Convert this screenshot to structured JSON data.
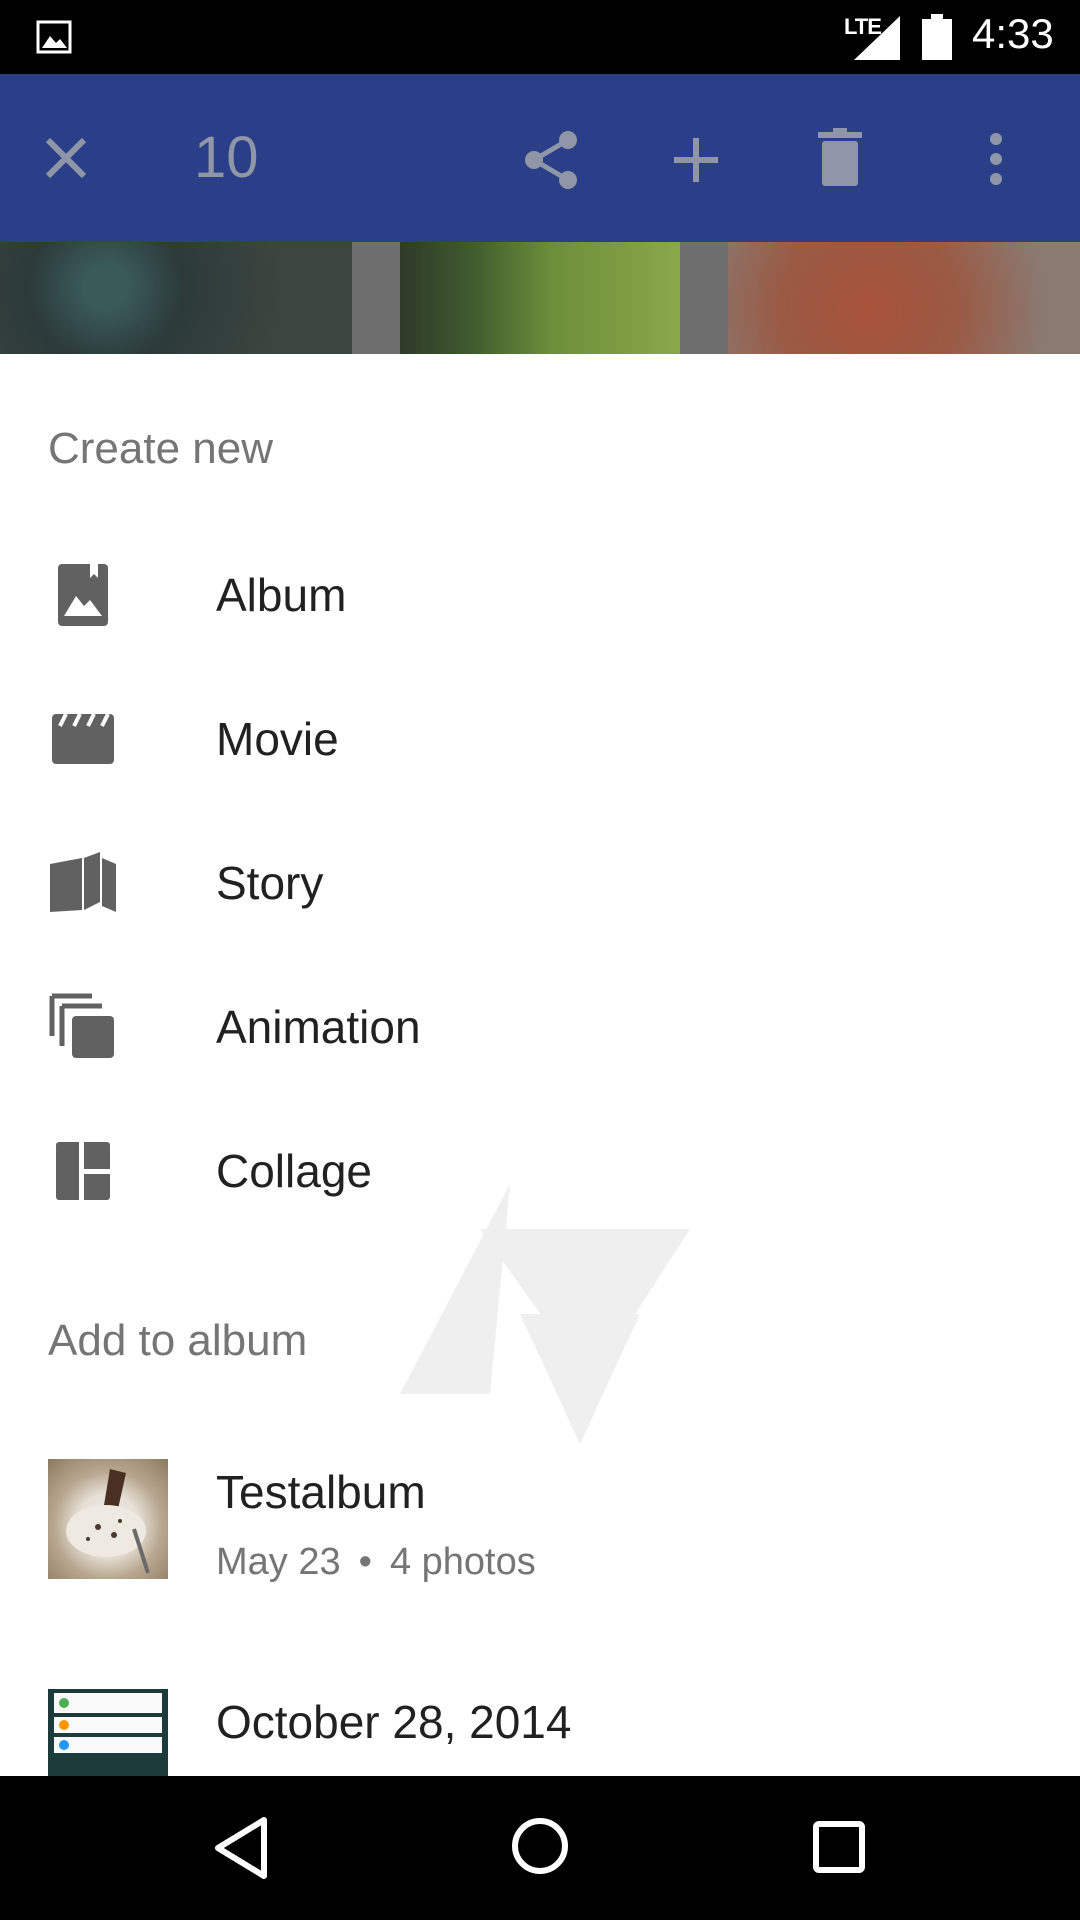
{
  "status_bar": {
    "network": "LTE",
    "time": "4:33",
    "icons": [
      "gallery-notification-icon",
      "signal-icon",
      "battery-icon"
    ]
  },
  "action_bar": {
    "selected_count": "10",
    "icons": [
      "close-icon",
      "share-icon",
      "add-icon",
      "delete-icon",
      "more-vert-icon"
    ],
    "color": "#2a3f87"
  },
  "sheet": {
    "create_new_title": "Create new",
    "create_items": [
      {
        "label": "Album",
        "icon": "photo-album-icon"
      },
      {
        "label": "Movie",
        "icon": "movie-clapper-icon"
      },
      {
        "label": "Story",
        "icon": "book-icon"
      },
      {
        "label": "Animation",
        "icon": "stacked-layers-icon"
      },
      {
        "label": "Collage",
        "icon": "collage-layout-icon"
      }
    ],
    "add_to_album_title": "Add to album",
    "albums": [
      {
        "title": "Testalbum",
        "date": "May 23",
        "separator": "•",
        "count": "4 photos"
      },
      {
        "title": "October 28, 2014"
      }
    ]
  },
  "nav_bar": {
    "icons": [
      "back-icon",
      "home-icon",
      "recents-icon"
    ]
  }
}
